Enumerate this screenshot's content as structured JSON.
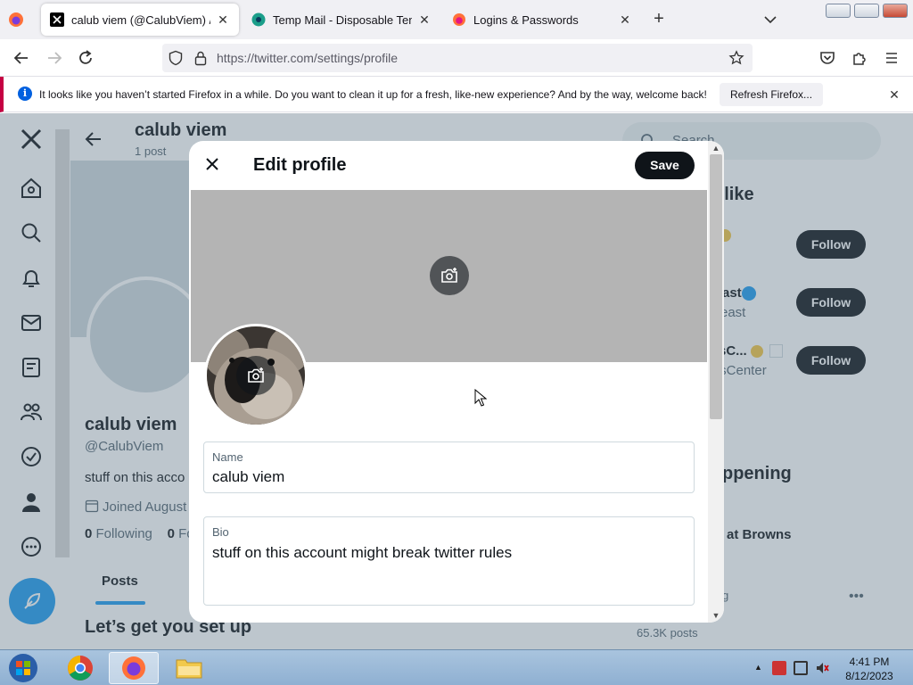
{
  "browser": {
    "tabs": [
      {
        "title": "calub viem (@CalubViem) / X",
        "active": true
      },
      {
        "title": "Temp Mail - Disposable Tempo",
        "active": false
      },
      {
        "title": "Logins & Passwords",
        "active": false
      }
    ],
    "new_tab_label": "+",
    "url": "https://twitter.com/settings/profile"
  },
  "notification": {
    "message": "It looks like you haven’t started Firefox in a while. Do you want to clean it up for a fresh, like-new experience? And by the way, welcome back!",
    "refresh_label": "Refresh Firefox..."
  },
  "background": {
    "header_name": "calub viem",
    "header_posts": "1 post",
    "name": "calub viem",
    "handle": "@CalubViem",
    "bio_partial": "stuff on this acco",
    "joined_partial": "Joined August",
    "following_count": "0",
    "following_label": "Following",
    "followers_count": "0",
    "followers_partial": "Fo",
    "active_tab": "Posts",
    "setup_heading": "Let’s get you set up",
    "search_placeholder": "Search",
    "might_like_partial": "t like",
    "suggestions": [
      {
        "name_partial": "",
        "handle_partial": "",
        "follow_label": "Follow"
      },
      {
        "name_partial": "ast",
        "handle_partial": "east",
        "follow_label": "Follow"
      },
      {
        "name_partial": "sC...",
        "handle_partial": "tsCenter",
        "follow_label": "Follow"
      }
    ],
    "happening_partial": "ppening",
    "trend_partial": "at Browns",
    "trend_meta_partial": "g",
    "trend_posts": "65.3K posts"
  },
  "modal": {
    "title": "Edit profile",
    "save_label": "Save",
    "name_label": "Name",
    "name_value": "calub viem",
    "bio_label": "Bio",
    "bio_value": "stuff on this account might break twitter rules"
  },
  "taskbar": {
    "time": "4:41 PM",
    "date": "8/12/2023"
  },
  "colors": {
    "accent": "#1d9bf0",
    "button_dark": "#0f1419",
    "notification_bar": "#c50042"
  }
}
